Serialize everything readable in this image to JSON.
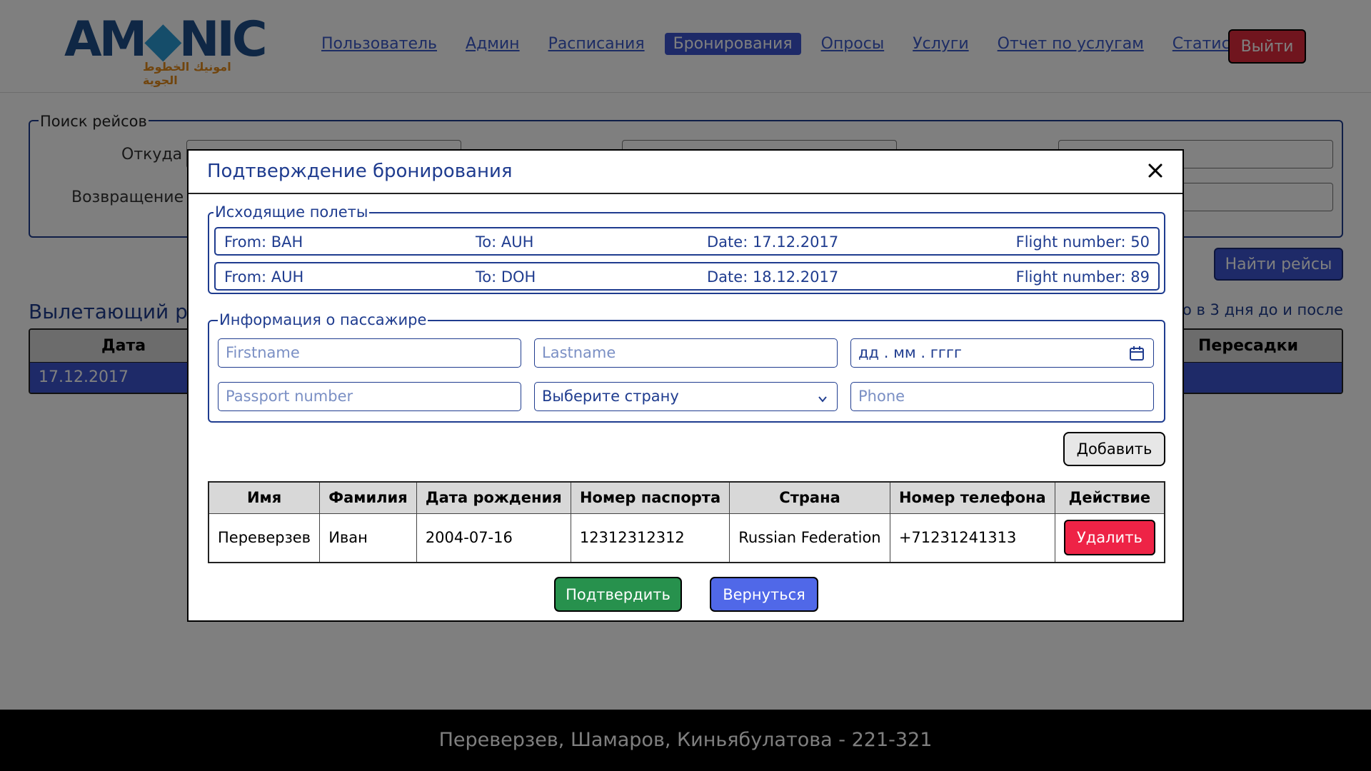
{
  "header": {
    "logo_text": "AMONIC",
    "logo_subtitle": "امونيك الخطوط الجوية",
    "nav": [
      {
        "label": "Пользователь",
        "active": false
      },
      {
        "label": "Админ",
        "active": false
      },
      {
        "label": "Расписания",
        "active": false
      },
      {
        "label": "Бронирования",
        "active": true
      },
      {
        "label": "Опросы",
        "active": false
      },
      {
        "label": "Услуги",
        "active": false
      },
      {
        "label": "Отчет по услугам",
        "active": false
      },
      {
        "label": "Статистика",
        "active": false
      }
    ],
    "logout_label": "Выйти"
  },
  "search": {
    "legend": "Поиск рейсов",
    "from_label": "Откуда",
    "return_label": "Возвращение",
    "find_button": "Найти рейсы"
  },
  "departing": {
    "title": "Вылетающий рейс",
    "note": "о в 3 дня до и после",
    "col_date": "Дата",
    "col_transfers": "Пересадки",
    "row_date": "17.12.2017"
  },
  "modal": {
    "title": "Подтверждение бронирования",
    "outgoing_legend": "Исходящие полеты",
    "flights": [
      {
        "from": "From: BAH",
        "to": "To: AUH",
        "date": "Date: 17.12.2017",
        "number": "Flight number: 50"
      },
      {
        "from": "From: AUH",
        "to": "To: DOH",
        "date": "Date: 18.12.2017",
        "number": "Flight number: 89"
      }
    ],
    "passenger_legend": "Информация о пассажире",
    "placeholders": {
      "firstname": "Firstname",
      "lastname": "Lastname",
      "birthdate": "дд . мм . гггг",
      "passport": "Passport number",
      "country": "Выберите страну",
      "phone": "Phone"
    },
    "add_button": "Добавить",
    "table": {
      "headers": [
        "Имя",
        "Фамилия",
        "Дата рождения",
        "Номер паспорта",
        "Страна",
        "Номер телефона",
        "Действие"
      ],
      "rows": [
        {
          "first": "Переверзев",
          "last": "Иван",
          "birth": "2004-07-16",
          "passport": "12312312312",
          "country": "Russian Federation",
          "phone": "+71231241313",
          "action": "Удалить"
        }
      ]
    },
    "confirm_button": "Подтвердить",
    "back_button": "Вернуться"
  },
  "footer": {
    "text": "Переверзев, Шамаров, Киньябулатова - 221-321"
  },
  "colors": {
    "accent": "#3c55d0",
    "danger": "#ee2346",
    "success": "#27914d",
    "navy": "#1f3c8f"
  }
}
